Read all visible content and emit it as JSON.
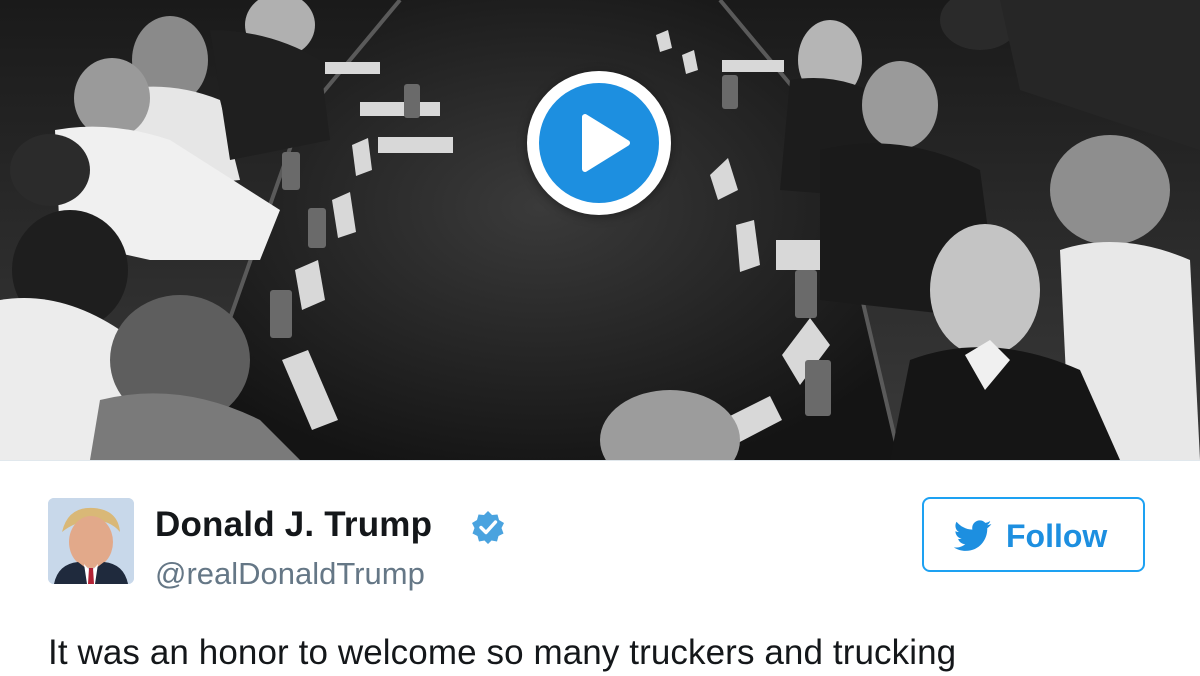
{
  "tweet": {
    "author_name": "Donald J. Trump",
    "handle": "@realDonaldTrump",
    "verified": true,
    "follow_label": "Follow",
    "text": "It was an honor to welcome so many truckers and trucking"
  },
  "media": {
    "type": "video",
    "play_icon": "play-icon"
  },
  "colors": {
    "accent": "#1da1f2",
    "play_button": "#1d8fe0",
    "name_text": "#14171a",
    "handle_text": "#657786"
  }
}
